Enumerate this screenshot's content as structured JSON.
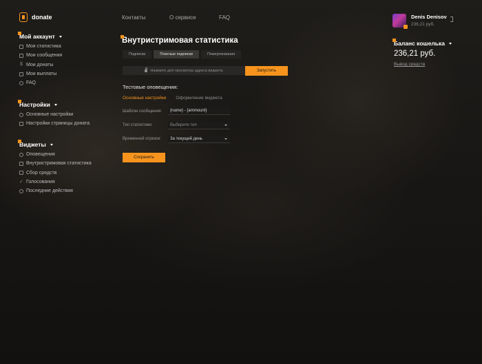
{
  "brand": {
    "name": "donate"
  },
  "topnav": [
    "Контакты",
    "О сервисе",
    "FAQ"
  ],
  "user": {
    "name": "Denis Denisov",
    "balance": "236,21 руб."
  },
  "sidebar": {
    "sections": [
      {
        "title": "Мой аккаунт",
        "items": [
          {
            "label": "Моя статистика",
            "icon": "chart-icon"
          },
          {
            "label": "Мои сообщения",
            "icon": "message-icon"
          },
          {
            "label": "Мои донаты",
            "icon": "dollar-icon"
          },
          {
            "label": "Мои выплаты",
            "icon": "document-icon"
          },
          {
            "label": "FAQ",
            "icon": "question-icon"
          }
        ]
      },
      {
        "title": "Настройки",
        "items": [
          {
            "label": "Основные настройки",
            "icon": "gear-icon"
          },
          {
            "label": "Настройки страницы доната",
            "icon": "page-icon"
          }
        ]
      },
      {
        "title": "Виджеты",
        "items": [
          {
            "label": "Оповещения",
            "icon": "bell-icon"
          },
          {
            "label": "Внутристримовая статистика",
            "icon": "stats-icon"
          },
          {
            "label": "Сбор средств",
            "icon": "fundraising-icon"
          },
          {
            "label": "Голосования",
            "icon": "check-icon"
          },
          {
            "label": "Последние действия",
            "icon": "clock-icon"
          }
        ]
      }
    ]
  },
  "main": {
    "title": "Внутристримовая статистика",
    "tabs": [
      "Подписки",
      "Платные подписки",
      "Пожертвования"
    ],
    "active_tab": 1,
    "url_placeholder": "Нажмите для просмотра адреса виджета",
    "run_label": "Запустить",
    "test_title": "Тестовые оповещения:",
    "subtabs": [
      "Основные настройки",
      "Оформление виджета"
    ],
    "form": {
      "template_label": "Шаблон сообщения:",
      "template_value": "{name} - {ammount}",
      "type_label": "Тип статистики:",
      "type_placeholder": "Выберите тип",
      "period_label": "Временной отрезок:",
      "period_value": "За текущий день"
    },
    "save_label": "Сохранить"
  },
  "wallet": {
    "title": "Баланс кошелька",
    "amount": "236,21 руб.",
    "withdraw_label": "Вывод средств"
  },
  "colors": {
    "accent": "#f7941d",
    "background": "#121110"
  }
}
